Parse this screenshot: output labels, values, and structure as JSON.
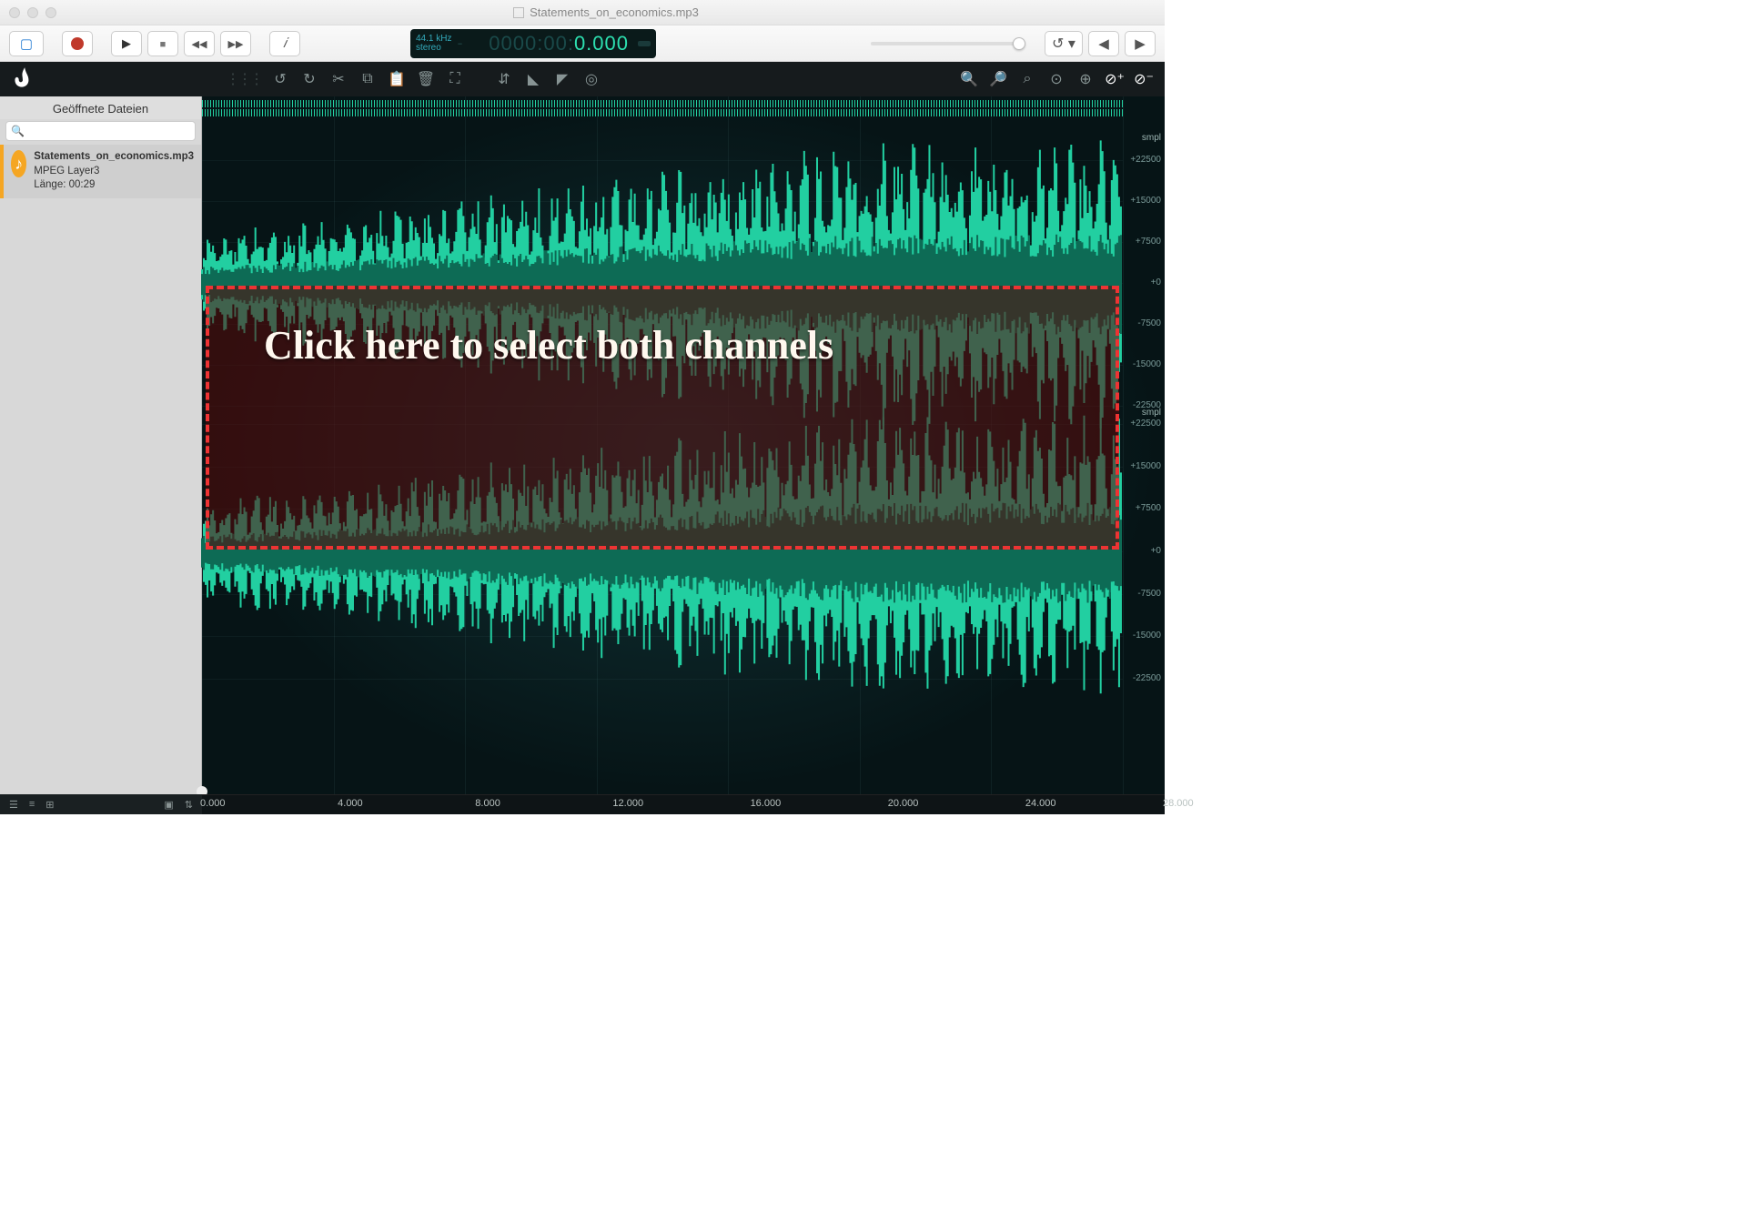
{
  "window": {
    "title": "Statements_on_economics.mp3"
  },
  "transport": {
    "sample_rate": "44.1 kHz",
    "channels": "stereo",
    "counter_dim": "0000:00:",
    "counter_lit": "0.000"
  },
  "sidebar": {
    "title": "Geöffnete Dateien",
    "search_placeholder": "",
    "file": {
      "name": "Statements_on_economics.mp3",
      "format": "MPEG Layer3",
      "length_label": "Länge: 00:29"
    }
  },
  "annotation": {
    "text": "Click here to select both channels"
  },
  "amplitude_ruler": {
    "unit": "smpl",
    "ticks": [
      "+22500",
      "+15000",
      "+7500",
      "+0",
      "-7500",
      "-15000",
      "-22500"
    ]
  },
  "time_ruler": {
    "ticks": [
      "0.000",
      "4.000",
      "8.000",
      "12.000",
      "16.000",
      "20.000",
      "24.000",
      "28.000"
    ]
  }
}
